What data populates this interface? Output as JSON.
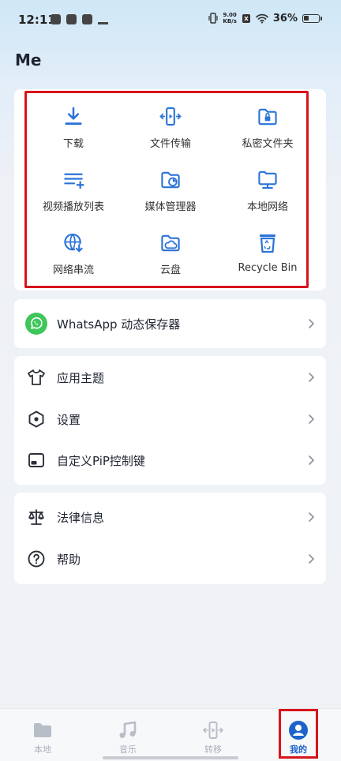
{
  "status_bar": {
    "time": "12:11",
    "speed_value": "9.00",
    "speed_unit": "KB/s",
    "battery": "36%"
  },
  "page": {
    "title": "Me"
  },
  "tools": [
    {
      "label": "下载",
      "icon": "download-icon"
    },
    {
      "label": "文件传输",
      "icon": "file-transfer-icon"
    },
    {
      "label": "私密文件夹",
      "icon": "private-folder-icon"
    },
    {
      "label": "视频播放列表",
      "icon": "video-playlist-icon"
    },
    {
      "label": "媒体管理器",
      "icon": "media-manager-icon"
    },
    {
      "label": "本地网络",
      "icon": "local-network-icon"
    },
    {
      "label": "网络串流",
      "icon": "network-stream-icon"
    },
    {
      "label": "云盘",
      "icon": "cloud-drive-icon"
    },
    {
      "label": "Recycle Bin",
      "icon": "recycle-bin-icon"
    }
  ],
  "whatsapp": {
    "label": "WhatsApp 动态保存器"
  },
  "settings_group": [
    {
      "label": "应用主题",
      "icon": "tshirt-icon"
    },
    {
      "label": "设置",
      "icon": "settings-hexagon-icon"
    },
    {
      "label": "自定义PiP控制键",
      "icon": "pip-icon"
    }
  ],
  "info_group": [
    {
      "label": "法律信息",
      "icon": "scales-icon"
    },
    {
      "label": "帮助",
      "icon": "help-icon"
    }
  ],
  "bottom_nav": [
    {
      "label": "本地",
      "icon": "folder-icon",
      "active": false
    },
    {
      "label": "音乐",
      "icon": "music-note-icon",
      "active": false
    },
    {
      "label": "转移",
      "icon": "transfer-icon",
      "active": false
    },
    {
      "label": "我的",
      "icon": "profile-icon",
      "active": true
    }
  ],
  "colors": {
    "accent": "#1e63c9",
    "highlight": "#d7141c",
    "whatsapp": "#3ec65a"
  }
}
